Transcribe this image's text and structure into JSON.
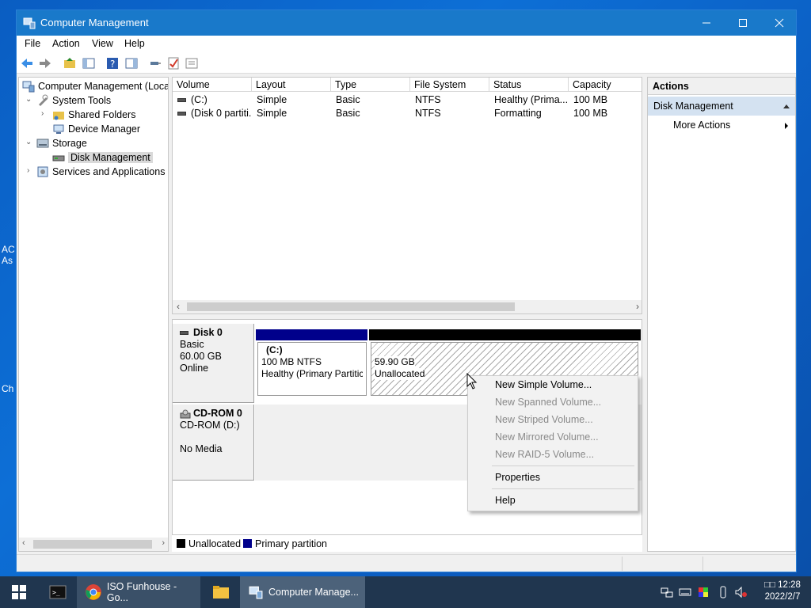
{
  "window": {
    "title": "Computer Management"
  },
  "menu": [
    "File",
    "Action",
    "View",
    "Help"
  ],
  "tree": {
    "root": "Computer Management (Local",
    "system_tools": "System Tools",
    "shared_folders": "Shared Folders",
    "device_manager": "Device Manager",
    "storage": "Storage",
    "disk_management": "Disk Management",
    "services": "Services and Applications"
  },
  "volumes": {
    "columns": [
      "Volume",
      "Layout",
      "Type",
      "File System",
      "Status",
      "Capacity"
    ],
    "rows": [
      [
        "(C:)",
        "Simple",
        "Basic",
        "NTFS",
        "Healthy (Prima...",
        "100 MB"
      ],
      [
        "(Disk 0 partiti...",
        "Simple",
        "Basic",
        "NTFS",
        "Formatting",
        "100 MB"
      ]
    ]
  },
  "disk0": {
    "name": "Disk 0",
    "type": "Basic",
    "size": "60.00 GB",
    "state": "Online",
    "p1": {
      "label": "(C:)",
      "size": "100 MB NTFS",
      "status": "Healthy (Primary Partitic"
    },
    "p2": {
      "size": "59.90 GB",
      "status": "Unallocated"
    }
  },
  "cdrom": {
    "name": "CD-ROM 0",
    "drive": "CD-ROM (D:)",
    "media": "No Media"
  },
  "legend": {
    "unallocated": "Unallocated",
    "primary": "Primary partition"
  },
  "actions": {
    "header": "Actions",
    "section": "Disk Management",
    "more": "More Actions"
  },
  "context_menu": {
    "new_simple": "New Simple Volume...",
    "new_spanned": "New Spanned Volume...",
    "new_striped": "New Striped Volume...",
    "new_mirrored": "New Mirrored Volume...",
    "new_raid5": "New RAID-5 Volume...",
    "properties": "Properties",
    "help": "Help"
  },
  "taskbar": {
    "chrome": "ISO Funhouse - Go...",
    "compmgmt": "Computer Manage...",
    "time": "12:28",
    "time_prefix": "□□",
    "date": "2022/2/7"
  },
  "desktop_fragments": [
    "AC",
    "As",
    "Ch"
  ],
  "colors": {
    "primary_partition": "#00008b",
    "unallocated": "#000000",
    "titlebar": "#1979ca",
    "selection": "#d4e2f1"
  }
}
